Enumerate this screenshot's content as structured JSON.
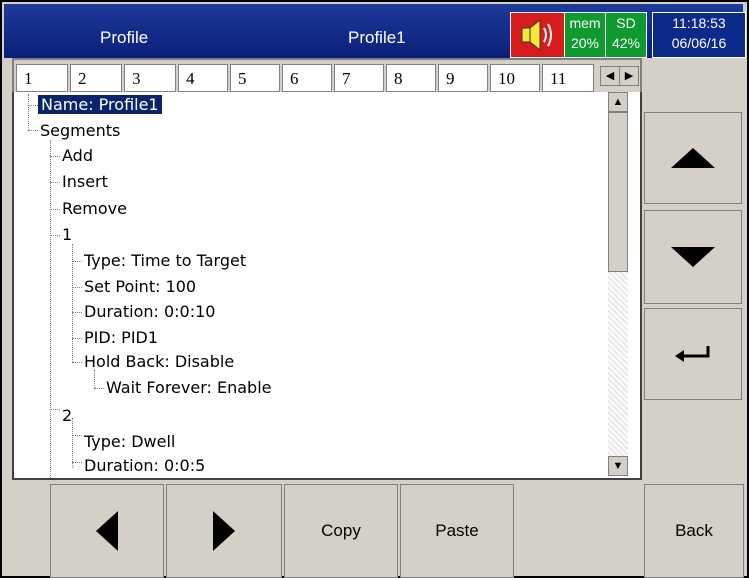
{
  "title_bar": {
    "screen_title": "Profile",
    "profile_name": "Profile1",
    "mem_label": "mem",
    "mem_value": "20%",
    "sd_label": "SD",
    "sd_value": "42%",
    "time": "11:18:53",
    "date": "06/06/16"
  },
  "tabs": [
    "1",
    "2",
    "3",
    "4",
    "5",
    "6",
    "7",
    "8",
    "9",
    "10",
    "11"
  ],
  "tree": [
    {
      "text": "Name: Profile1"
    },
    {
      "text": "Segments"
    },
    {
      "text": "Add"
    },
    {
      "text": "Insert"
    },
    {
      "text": "Remove"
    },
    {
      "text": "1"
    },
    {
      "text": "Type: Time to Target"
    },
    {
      "text": "Set Point: 100"
    },
    {
      "text": "Duration: 0:0:10"
    },
    {
      "text": "PID: PID1"
    },
    {
      "text": "Hold Back: Disable"
    },
    {
      "text": "Wait Forever: Enable"
    },
    {
      "text": "2"
    },
    {
      "text": "Type: Dwell"
    },
    {
      "text": "Duration: 0:0:5"
    }
  ],
  "bottom_buttons": {
    "copy": "Copy",
    "paste": "Paste",
    "back": "Back"
  },
  "colors": {
    "title_bar": "#0a1f78",
    "status_green": "#0e9a2e",
    "speaker_red": "#d81b1b",
    "selection": "#0a246a",
    "panel_gray": "#d4d0c8"
  },
  "icons": [
    "speaker-icon",
    "arrow-up-icon",
    "arrow-down-icon",
    "enter-icon",
    "arrow-left-icon",
    "arrow-right-icon"
  ]
}
